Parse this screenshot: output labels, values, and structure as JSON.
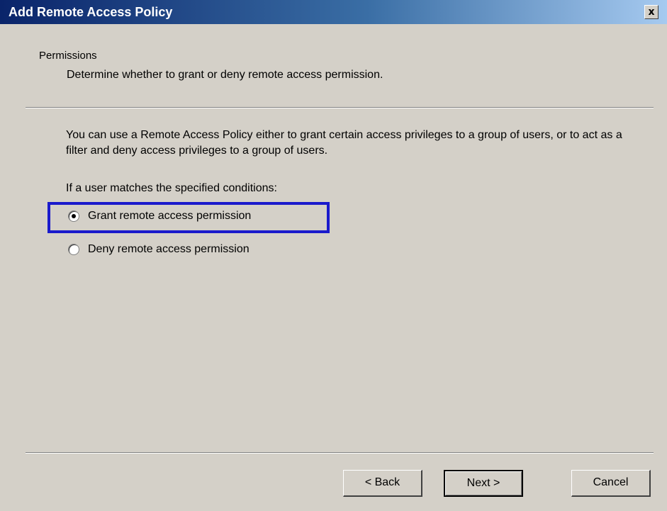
{
  "window": {
    "title": "Add Remote Access Policy",
    "close_label": "x"
  },
  "header": {
    "title": "Permissions",
    "subtitle": "Determine whether to grant or deny remote access permission."
  },
  "body": {
    "description": "You can use a Remote Access Policy either to grant certain access privileges to a group of users, or to act as a filter and deny access privileges to a group of users.",
    "condition_label": "If a user matches the specified conditions:",
    "options": [
      {
        "label": "Grant remote access permission",
        "selected": true
      },
      {
        "label": "Deny remote access permission",
        "selected": false
      }
    ]
  },
  "buttons": {
    "back": "< Back",
    "next": "Next >",
    "cancel": "Cancel"
  },
  "colors": {
    "titlebar_start": "#0a246a",
    "titlebar_end": "#a6caf0",
    "dialog_background": "#d4d0c8",
    "highlight_box": "#1a1acc"
  }
}
